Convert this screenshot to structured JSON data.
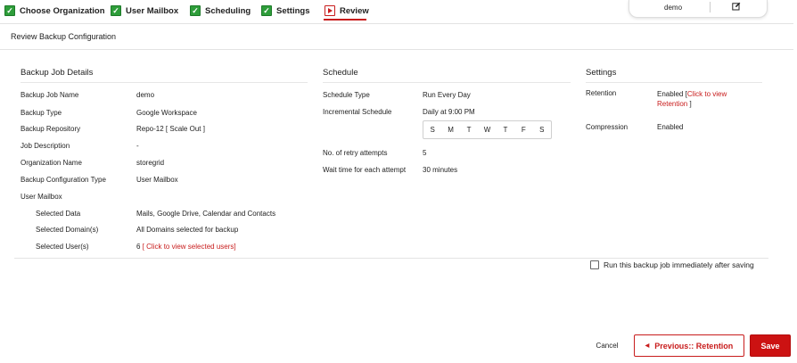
{
  "wizard": {
    "steps": [
      {
        "label": "Choose Organization",
        "status": "completed"
      },
      {
        "label": "User Mailbox",
        "status": "completed"
      },
      {
        "label": "Scheduling",
        "status": "completed"
      },
      {
        "label": "Settings",
        "status": "completed"
      },
      {
        "label": "Review",
        "status": "active"
      }
    ],
    "colors": {
      "completed": "#2e9d3a",
      "active": "#c81c1c"
    }
  },
  "user_tab": {
    "name": "demo",
    "icon": "edit-icon"
  },
  "page_title": "Review Backup Configuration",
  "job_details": {
    "heading": "Backup Job Details",
    "rows": [
      {
        "label": "Backup Job Name",
        "value": "demo"
      },
      {
        "label": "Backup Type",
        "value": "Google Workspace"
      },
      {
        "label": "Backup Repository",
        "value": "Repo-12 [ Scale Out ]"
      },
      {
        "label": "Job Description",
        "value": "-"
      },
      {
        "label": "Organization Name",
        "value": "storegrid"
      },
      {
        "label": "Backup Configuration Type",
        "value": "User Mailbox"
      }
    ],
    "user_mailbox": {
      "label": "User Mailbox",
      "selected_data_label": "Selected Data",
      "selected_data_value": "Mails, Google Drive, Calendar and Contacts",
      "selected_domains_label": "Selected Domain(s)",
      "selected_domains_value": "All Domains selected for backup",
      "selected_users_label": "Selected User(s)",
      "selected_users_count": "6",
      "selected_users_link": "[ Click to view selected users]"
    }
  },
  "schedule": {
    "heading": "Schedule",
    "schedule_type_label": "Schedule Type",
    "schedule_type_value": "Run Every Day",
    "incremental_label": "Incremental Schedule",
    "incremental_value": "Daily at 9:00 PM",
    "days": [
      "S",
      "M",
      "T",
      "W",
      "T",
      "F",
      "S"
    ],
    "retry_label": "No. of retry attempts",
    "retry_value": "5",
    "wait_label": "Wait time for each attempt",
    "wait_value": "30 minutes"
  },
  "settings": {
    "heading": "Settings",
    "retention_label": "Retention",
    "retention_value": "Enabled",
    "retention_link_open": "[",
    "retention_link_text_1": "Click to view",
    "retention_link_text_2": "Retention",
    "retention_link_close": "]",
    "compression_label": "Compression",
    "compression_value": "Enabled"
  },
  "run_now": {
    "label": "Run this backup job immediately after saving",
    "checked": false
  },
  "footer": {
    "cancel_label": "Cancel",
    "previous_label": "Previous:: Retention",
    "save_label": "Save"
  },
  "colors": {
    "accent": "#c81c1c",
    "save_bg": "#cc1212"
  }
}
